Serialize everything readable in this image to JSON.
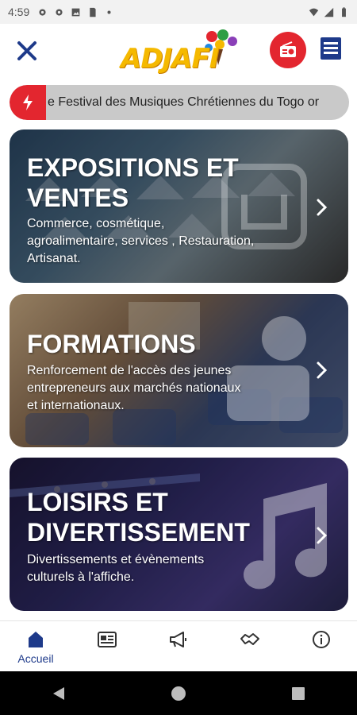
{
  "status_bar": {
    "time": "4:59",
    "icons": [
      "gear-icon",
      "gear-icon",
      "image-icon",
      "sd-card-icon",
      "dot-icon"
    ],
    "right_icons": [
      "wifi-icon",
      "signal-icon",
      "battery-icon"
    ]
  },
  "header": {
    "logo_text": "ADJAFI",
    "close_icon": "close-icon",
    "radio_icon": "radio-icon",
    "menu_icon": "menu-icon",
    "accent_color": "#e3262f",
    "brand_color": "#1e3a8a"
  },
  "ticker": {
    "icon": "lightning-icon",
    "text": "e Festival des Musiques Chrétiennes du Togo or"
  },
  "cards": [
    {
      "title_line1": "EXPOSITIONS ET",
      "title_line2": "VENTES",
      "desc_line1": "Commerce, cosmétique,",
      "desc_line2": "agroalimentaire, services , Restauration,",
      "desc_line3": "Artisanat.",
      "icon": "shop-icon"
    },
    {
      "title_line1": "FORMATIONS",
      "desc_line1": "Renforcement de l'accès des jeunes",
      "desc_line2": "entrepreneurs aux marchés nationaux",
      "desc_line3": "et internationaux.",
      "icon": "user-icon"
    },
    {
      "title_line1": "LOISIRS ET",
      "title_line2": "DIVERTISSEMENT",
      "desc_line1": "Divertissements et évènements",
      "desc_line2": "culturels à l'affiche.",
      "icon": "music-note-icon"
    }
  ],
  "bottom_nav": {
    "items": [
      {
        "label": "Accueil",
        "icon": "home-icon",
        "active": true
      },
      {
        "label": "",
        "icon": "newspaper-icon"
      },
      {
        "label": "",
        "icon": "megaphone-icon"
      },
      {
        "label": "",
        "icon": "handshake-icon"
      },
      {
        "label": "",
        "icon": "info-icon"
      }
    ]
  },
  "android_nav": [
    "back-icon",
    "home-circle-icon",
    "recents-icon"
  ]
}
